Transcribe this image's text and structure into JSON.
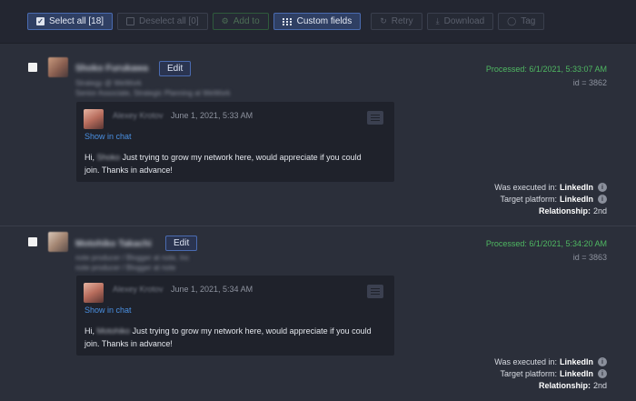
{
  "toolbar": {
    "select_all": "Select all [18]",
    "deselect_all": "Deselect all [0]",
    "add_to": "Add to",
    "custom_fields": "Custom fields",
    "retry": "Retry",
    "download": "Download",
    "tag": "Tag",
    "accent_color": "#4a6bb0"
  },
  "records": [
    {
      "name": "Shoko Furukawa",
      "edit_label": "Edit",
      "company": "Strategy @ WeWork",
      "headline": "Senior Associate, Strategic Planning at WeWork",
      "processed": "Processed: 6/1/2021, 5:33:07 AM",
      "record_id": "id = 3862",
      "message": {
        "author": "Alexey Krotov",
        "date": "June 1, 2021, 5:33 AM",
        "show_chat": "Show in chat",
        "greeting": "Hi,",
        "recipient": "Shoko",
        "text": "Just trying to grow my network here, would appreciate if you could join. Thanks in advance!"
      },
      "executed_label": "Was executed in:",
      "executed_value": "LinkedIn",
      "target_label": "Target platform:",
      "target_value": "LinkedIn",
      "relationship_label": "Relationship:",
      "relationship_value": "2nd"
    },
    {
      "name": "Motohiko Takachi",
      "edit_label": "Edit",
      "company": "note producer / Blogger at note, Inc",
      "headline": "note producer / Blogger at note",
      "processed": "Processed: 6/1/2021, 5:34:20 AM",
      "record_id": "id = 3863",
      "message": {
        "author": "Alexey Krotov",
        "date": "June 1, 2021, 5:34 AM",
        "show_chat": "Show in chat",
        "greeting": "Hi,",
        "recipient": "Motohiko",
        "text": "Just trying to grow my network here, would appreciate if you could join. Thanks in advance!"
      },
      "executed_label": "Was executed in:",
      "executed_value": "LinkedIn",
      "target_label": "Target platform:",
      "target_value": "LinkedIn",
      "relationship_label": "Relationship:",
      "relationship_value": "2nd"
    }
  ]
}
